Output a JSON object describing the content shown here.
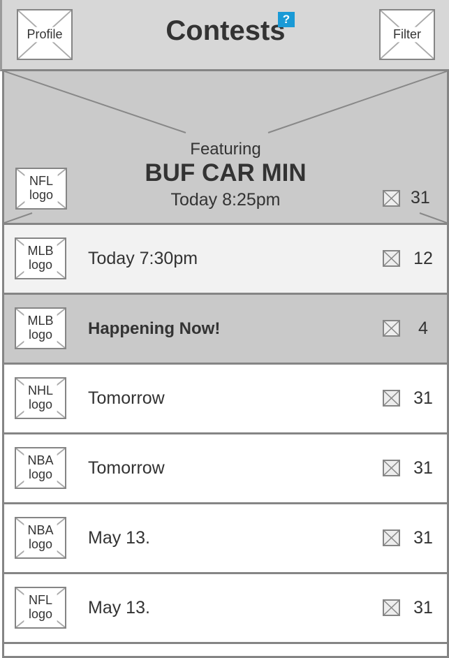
{
  "header": {
    "title": "Contests",
    "help_label": "?",
    "profile_label": "Profile",
    "filter_label": "Filter"
  },
  "featured": {
    "caption": "Featuring",
    "teams": "BUF CAR MIN",
    "time": "Today 8:25pm",
    "logo_line1": "NFL",
    "logo_line2": "logo",
    "count": "31"
  },
  "contests": [
    {
      "league": "MLB",
      "logo_word": "logo",
      "label": "Today 7:30pm",
      "count": "12",
      "bg": "#f2f2f2",
      "bold": false
    },
    {
      "league": "MLB",
      "logo_word": "logo",
      "label": "Happening Now!",
      "count": "4",
      "bg": "#c9c9c9",
      "bold": true
    },
    {
      "league": "NHL",
      "logo_word": "logo",
      "label": "Tomorrow",
      "count": "31",
      "bg": "#ffffff",
      "bold": false
    },
    {
      "league": "NBA",
      "logo_word": "logo",
      "label": "Tomorrow",
      "count": "31",
      "bg": "#ffffff",
      "bold": false
    },
    {
      "league": "NBA",
      "logo_word": "logo",
      "label": "May 13.",
      "count": "31",
      "bg": "#ffffff",
      "bold": false
    },
    {
      "league": "NFL",
      "logo_word": "logo",
      "label": "May 13.",
      "count": "31",
      "bg": "#ffffff",
      "bold": false
    }
  ]
}
